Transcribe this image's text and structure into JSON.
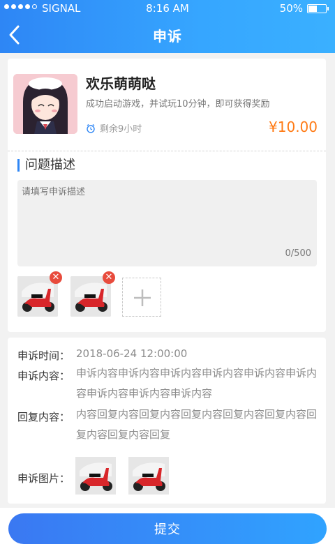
{
  "statusbar": {
    "carrier": "SIGNAL",
    "time": "8:16 AM",
    "battery": "50%"
  },
  "nav": {
    "title": "申诉"
  },
  "game": {
    "title": "欢乐萌萌哒",
    "desc": "成功启动游戏，并试玩10分钟，即可获得奖励",
    "remaining": "剩余9小时",
    "price": "¥10.00"
  },
  "problem": {
    "title": "问题描述",
    "placeholder": "请填写申诉描述",
    "counter": "0/500"
  },
  "details": {
    "time_label": "申诉时间：",
    "time_value": "2018-06-24 12:00:00",
    "content_label": "申诉内容：",
    "content_value": "申诉内容申诉内容申诉内容申诉内容申诉内容申诉内容申诉内容申诉内容申诉内容",
    "reply_label": "回复内容：",
    "reply_value": "内容回复内容回复内容回复内容回复内容回复内容回复内容回复内容回复",
    "pics_label": "申诉图片："
  },
  "submit_label": "提交",
  "colors": {
    "accent": "#2e86f5",
    "price": "#ff7a14",
    "delete": "#e84b3c"
  }
}
